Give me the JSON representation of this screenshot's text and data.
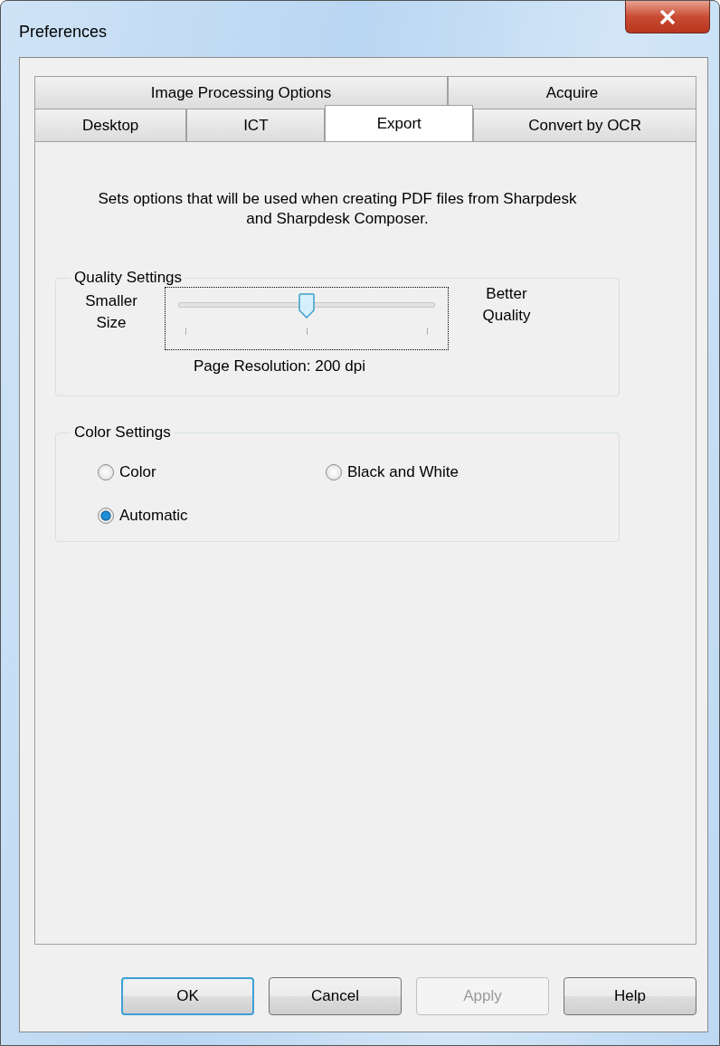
{
  "window": {
    "title": "Preferences"
  },
  "tab_rows": [
    [
      {
        "label": "Image Processing Options",
        "selected": false
      },
      {
        "label": "Acquire",
        "selected": false
      }
    ],
    [
      {
        "label": "Desktop",
        "selected": false
      },
      {
        "label": "ICT",
        "selected": false
      },
      {
        "label": "Export",
        "selected": true
      },
      {
        "label": "Convert by OCR",
        "selected": false
      }
    ]
  ],
  "description": "Sets options that will be used when creating PDF files from Sharpdesk and Sharpdesk Composer.",
  "quality_settings": {
    "title": "Quality Settings",
    "left_label": "Smaller Size",
    "right_label": "Better Quality",
    "slider": {
      "level": 0.5
    },
    "reading": "Page Resolution: 200 dpi"
  },
  "color_settings": {
    "title": "Color Settings",
    "options": [
      {
        "label": "Color",
        "selected": false
      },
      {
        "label": "Black and White",
        "selected": false
      },
      {
        "label": "Automatic",
        "selected": true
      }
    ]
  },
  "buttons": [
    {
      "label": "OK",
      "default": true,
      "disabled": false
    },
    {
      "label": "Cancel",
      "default": false,
      "disabled": false
    },
    {
      "label": "Apply",
      "default": false,
      "disabled": true
    },
    {
      "label": "Help",
      "default": false,
      "disabled": false
    }
  ]
}
